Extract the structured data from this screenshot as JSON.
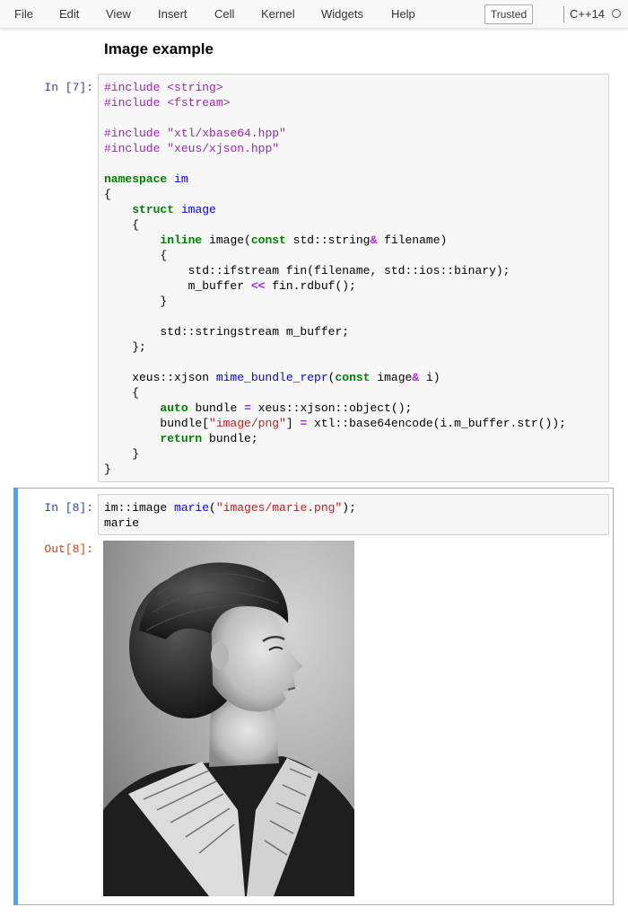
{
  "menubar": {
    "items": [
      "File",
      "Edit",
      "View",
      "Insert",
      "Cell",
      "Kernel",
      "Widgets",
      "Help"
    ],
    "trusted_label": "Trusted",
    "kernel_name": "C++14"
  },
  "notebook": {
    "markdown_heading": "Image example",
    "cells": [
      {
        "prompt": "In [7]:",
        "code_lines": [
          "#include <string>",
          "#include <fstream>",
          "",
          "#include \"xtl/xbase64.hpp\"",
          "#include \"xeus/xjson.hpp\"",
          "",
          "namespace im",
          "{",
          "    struct image",
          "    {",
          "        inline image(const std::string& filename)",
          "        {",
          "            std::ifstream fin(filename, std::ios::binary);",
          "            m_buffer << fin.rdbuf();",
          "        }",
          "",
          "        std::stringstream m_buffer;",
          "    };",
          "",
          "    xeus::xjson mime_bundle_repr(const image& i)",
          "    {",
          "        auto bundle = xeus::xjson::object();",
          "        bundle[\"image/png\"] = xtl::base64encode(i.m_buffer.str());",
          "        return bundle;",
          "    }",
          "}"
        ]
      },
      {
        "prompt": "In [8]:",
        "code_lines": [
          "im::image marie(\"images/marie.png\");",
          "marie"
        ],
        "output_prompt": "Out[8]:",
        "output_image": "portrait-photo"
      }
    ]
  },
  "colors": {
    "in_prompt": "#303f9f",
    "out_prompt": "#d84315",
    "selected_cell_bar": "#42a5f5",
    "keyword": "#008000",
    "preprocessor": "#9c27b0",
    "string": "#ba2121",
    "function_name": "#0000ff"
  }
}
